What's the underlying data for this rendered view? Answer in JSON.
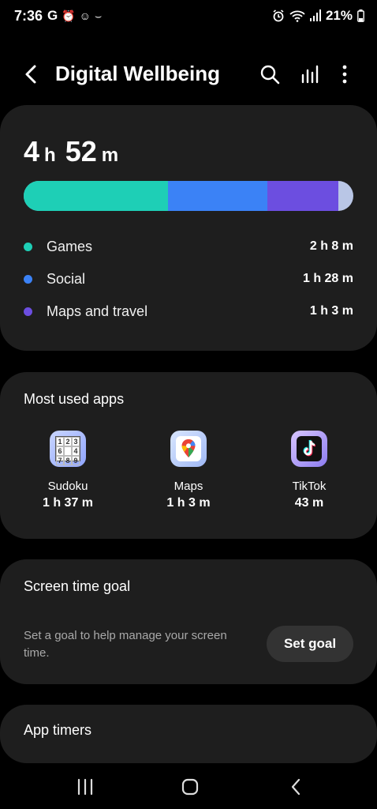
{
  "status_bar": {
    "time": "7:36",
    "left_icons": [
      "G",
      "⏰",
      "☺",
      "⌣"
    ],
    "battery": "21%"
  },
  "header": {
    "title": "Digital Wellbeing"
  },
  "usage": {
    "total_hours": "4",
    "hours_unit": "h",
    "total_minutes": "52",
    "minutes_unit": "m",
    "categories": [
      {
        "label": "Games",
        "value": "2 h 8 m",
        "minutes": 128,
        "color": "#1ecfb6"
      },
      {
        "label": "Social",
        "value": "1 h 28 m",
        "minutes": 88,
        "color": "#3b82f6"
      },
      {
        "label": "Maps and travel",
        "value": "1 h 3 m",
        "minutes": 63,
        "color": "#6c4ee0"
      }
    ],
    "remainder_color": "#b9c6e6"
  },
  "most_used": {
    "title": "Most used apps",
    "apps": [
      {
        "name": "Sudoku",
        "time": "1 h 37 m",
        "icon": "sudoku-icon",
        "digits": [
          "1",
          "2",
          "3",
          "6",
          "",
          "4",
          "7",
          "8",
          "9"
        ]
      },
      {
        "name": "Maps",
        "time": "1 h 3 m",
        "icon": "maps-icon"
      },
      {
        "name": "TikTok",
        "time": "43 m",
        "icon": "tiktok-icon"
      }
    ]
  },
  "goal": {
    "title": "Screen time goal",
    "description": "Set a goal to help manage your screen time.",
    "button": "Set goal"
  },
  "timers": {
    "title": "App timers"
  }
}
